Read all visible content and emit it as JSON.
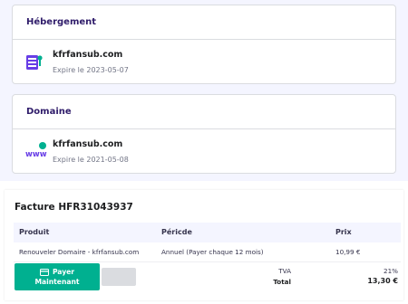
{
  "hosting_card": {
    "heading": "Hébergement",
    "domain": "kfrfansub.com",
    "expiry": "Expire le 2023-05-07"
  },
  "domain_card": {
    "heading": "Domaine",
    "domain": "kfrfansub.com",
    "expiry": "Expire le 2021-05-08",
    "icon_text": "www"
  },
  "invoice": {
    "title": "Facture HFR31043937",
    "columns": {
      "product": "Produit",
      "period": "Péricde",
      "price": "Prix"
    },
    "rows": [
      {
        "product": "Renouveler Domaire - kfrfansub.com",
        "period": "Annuel (Payer chaque 12 mois)",
        "price": "10,99 €"
      }
    ],
    "pay_button": {
      "line1": "Payer",
      "line2": "Maintenant"
    },
    "tax_label": "TVA",
    "tax_value": "21%",
    "total_label": "Total",
    "total_value": "13,30 €"
  },
  "colors": {
    "accent_green": "#00b090",
    "brand_purple": "#673de6",
    "brand_teal": "#00b090"
  }
}
